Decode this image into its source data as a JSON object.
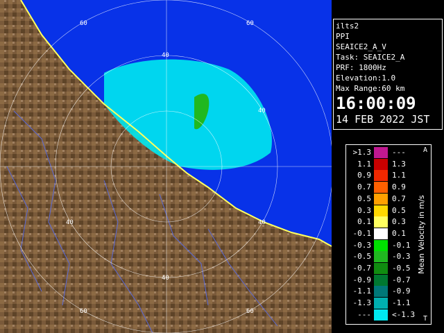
{
  "panel": {
    "site": "ilts2",
    "product": "PPI",
    "scan": "SEAICE2_A_V",
    "task": "Task: SEAICE2_A",
    "prf": "PRF: 1800Hz",
    "elevation": "Elevation:1.0",
    "max_range": "Max Range:60 km",
    "time": "16:00:09",
    "date": "14 FEB 2022 JST"
  },
  "legend": {
    "title": "Mean Velocity in m/s",
    "top_mark": "A",
    "bottom_mark": "T",
    "rows": [
      {
        "lo": ">1.3",
        "hi": "---",
        "color": "#c01890"
      },
      {
        "lo": "1.1",
        "hi": "1.3",
        "color": "#c80000"
      },
      {
        "lo": "0.9",
        "hi": "1.1",
        "color": "#f02800"
      },
      {
        "lo": "0.7",
        "hi": "0.9",
        "color": "#ff6000"
      },
      {
        "lo": "0.5",
        "hi": "0.7",
        "color": "#ffa000"
      },
      {
        "lo": "0.3",
        "hi": "0.5",
        "color": "#ffd800"
      },
      {
        "lo": "0.1",
        "hi": "0.3",
        "color": "#ffff60"
      },
      {
        "lo": "-0.1",
        "hi": "0.1",
        "color": "#ffffff"
      },
      {
        "lo": "-0.3",
        "hi": "-0.1",
        "color": "#00e000"
      },
      {
        "lo": "-0.5",
        "hi": "-0.3",
        "color": "#20b820"
      },
      {
        "lo": "-0.7",
        "hi": "-0.5",
        "color": "#108c10"
      },
      {
        "lo": "-0.9",
        "hi": "-0.7",
        "color": "#007830"
      },
      {
        "lo": "-1.1",
        "hi": "-0.9",
        "color": "#007878"
      },
      {
        "lo": "-1.3",
        "hi": "-1.1",
        "color": "#00b0b0"
      },
      {
        "lo": "---",
        "hi": "<-1.3",
        "color": "#00e8f0"
      }
    ]
  },
  "map": {
    "range_labels": [
      "60",
      "60",
      "40",
      "40",
      "40",
      "40",
      "40",
      "60",
      "60"
    ],
    "colors": {
      "sea": "#0832e8",
      "land": "#7a5a3a",
      "echo": "#00e8f0",
      "rivers": "#5a6ad8"
    }
  }
}
